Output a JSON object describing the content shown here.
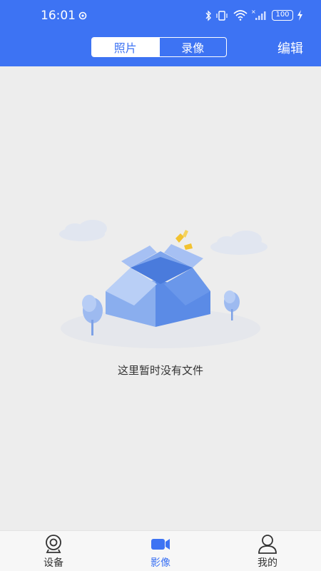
{
  "status_bar": {
    "time": "16:01",
    "battery": "100"
  },
  "header": {
    "tabs": [
      {
        "label": "照片",
        "active": true
      },
      {
        "label": "录像",
        "active": false
      }
    ],
    "edit_label": "编辑",
    "accent_color": "#3d73f3"
  },
  "empty_state": {
    "message": "这里暂时没有文件",
    "icon": "open-box-illustration"
  },
  "tabbar": {
    "items": [
      {
        "label": "设备",
        "icon": "camera-icon",
        "active": false
      },
      {
        "label": "影像",
        "icon": "video-icon",
        "active": true
      },
      {
        "label": "我的",
        "icon": "user-icon",
        "active": false
      }
    ]
  }
}
